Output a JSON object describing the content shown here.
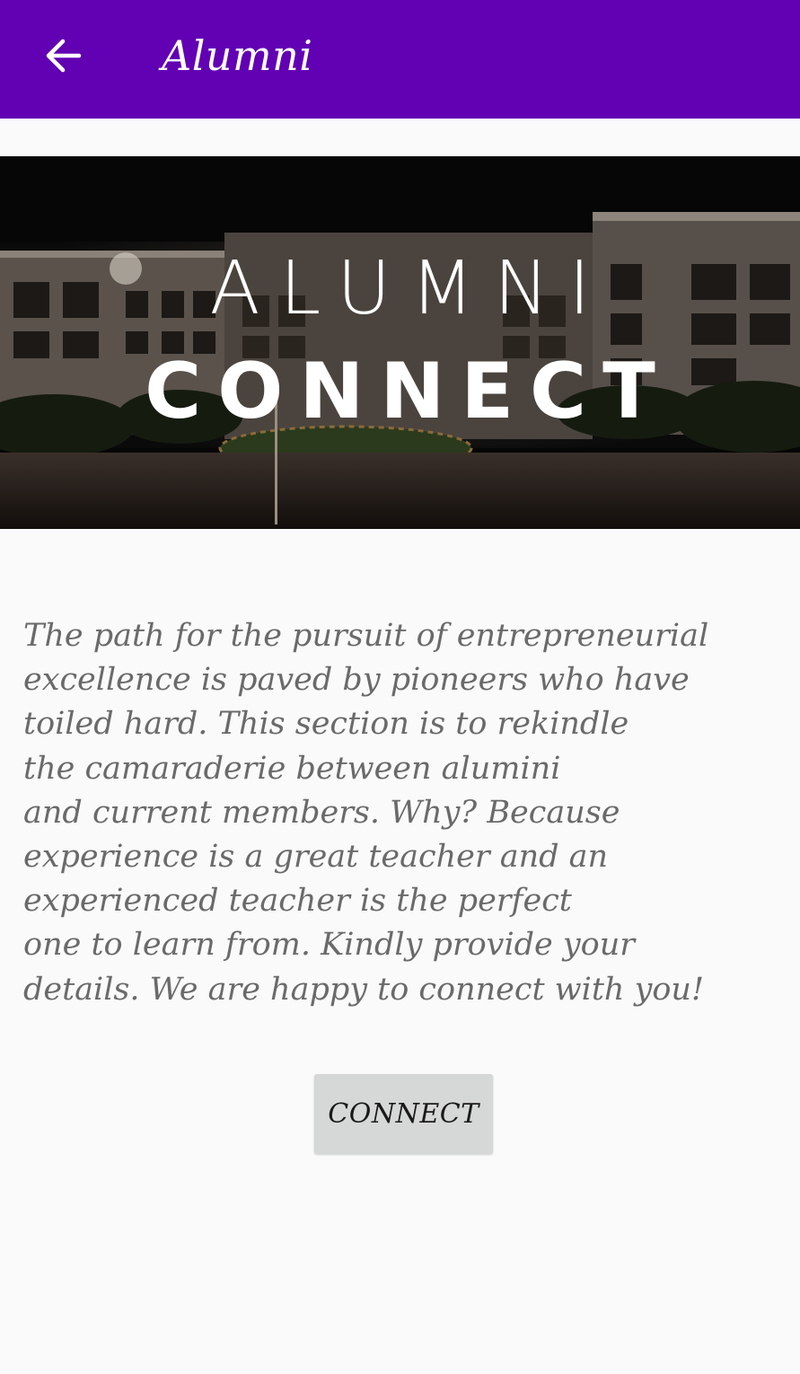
{
  "app_bar": {
    "title": "Alumni",
    "back_icon": "arrow-left-icon",
    "background": "#6200b3"
  },
  "banner": {
    "line1": "ALUMNI",
    "line2": "CONNECT"
  },
  "description": {
    "lines": [
      "The path for the pursuit of entrepreneurial",
      "excellence is paved by pioneers who have",
      "toiled hard. This section is to rekindle",
      "the camaraderie between alumini",
      "and current members. Why? Because",
      "experience is a great teacher and an",
      "experienced teacher is the perfect",
      "one to learn from. Kindly provide your",
      "details. We are happy to connect with you!"
    ]
  },
  "connect_button": {
    "label": "CONNECT"
  }
}
